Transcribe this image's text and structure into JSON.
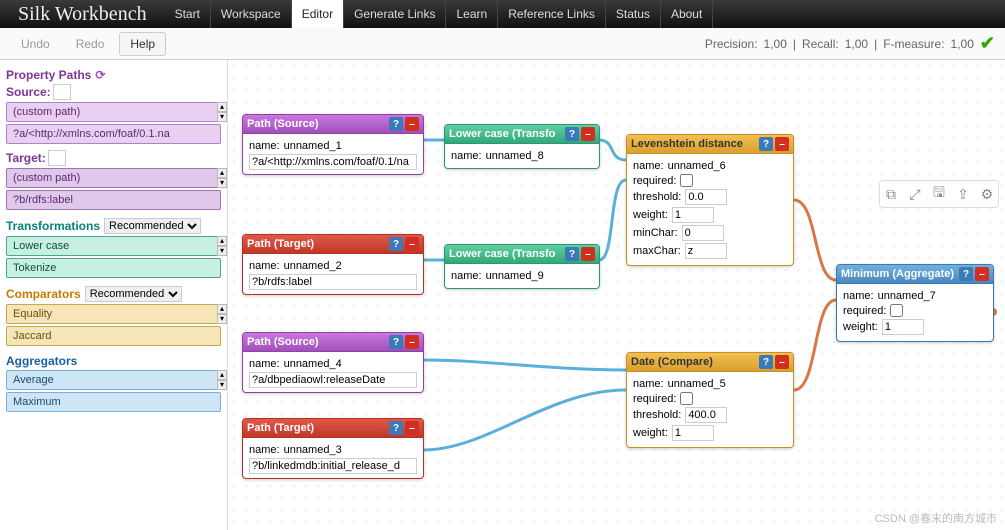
{
  "app": {
    "title": "Silk Workbench"
  },
  "navTabs": [
    "Start",
    "Workspace",
    "Editor",
    "Generate Links",
    "Learn",
    "Reference Links",
    "Status",
    "About"
  ],
  "activeTab": "Editor",
  "toolbar": {
    "undo": "Undo",
    "redo": "Redo",
    "help": "Help"
  },
  "metrics": {
    "precision_label": "Precision:",
    "precision": "1,00",
    "recall_label": "Recall:",
    "recall": "1,00",
    "f_label": "F-measure:",
    "f": "1,00"
  },
  "sidebar": {
    "paths_title": "Property Paths",
    "source_label": "Source:",
    "target_label": "Target:",
    "source_items": [
      "(custom path)",
      "?a/<http://xmlns.com/foaf/0.1.na"
    ],
    "target_items": [
      "(custom path)",
      "?b/rdfs:label"
    ],
    "trans_title": "Transformations",
    "trans_mode": "Recommended",
    "trans_items": [
      "Lower case",
      "Tokenize"
    ],
    "comp_title": "Comparators",
    "comp_mode": "Recommended",
    "comp_items": [
      "Equality",
      "Jaccard"
    ],
    "agg_title": "Aggregators",
    "agg_items": [
      "Average",
      "Maximum"
    ]
  },
  "nodes": {
    "src1": {
      "title": "Path (Source)",
      "name": "unnamed_1",
      "path": "?a/<http://xmlns.com/foaf/0.1/na"
    },
    "tgt1": {
      "title": "Path (Target)",
      "name": "unnamed_2",
      "path": "?b/rdfs:label"
    },
    "src2": {
      "title": "Path (Source)",
      "name": "unnamed_4",
      "path": "?a/dbpediaowl:releaseDate"
    },
    "tgt2": {
      "title": "Path (Target)",
      "name": "unnamed_3",
      "path": "?b/linkedmdb:initial_release_d"
    },
    "tr1": {
      "title": "Lower case (Transfo",
      "name": "unnamed_8"
    },
    "tr2": {
      "title": "Lower case (Transfo",
      "name": "unnamed_9"
    },
    "cmp1": {
      "title": "Levenshtein distance",
      "name": "unnamed_6",
      "threshold": "0.0",
      "weight": "1",
      "minChar": "0",
      "maxChar": "z"
    },
    "cmp2": {
      "title": "Date (Compare)",
      "name": "unnamed_5",
      "threshold": "400.0",
      "weight": "1"
    },
    "agg": {
      "title": "Minimum (Aggregate)",
      "name": "unnamed_7",
      "weight": "1"
    }
  },
  "labels": {
    "name": "name:",
    "required": "required:",
    "threshold": "threshold:",
    "weight": "weight:",
    "minChar": "minChar:",
    "maxChar": "maxChar:"
  },
  "watermark": "CSDN @春末的南方城市"
}
